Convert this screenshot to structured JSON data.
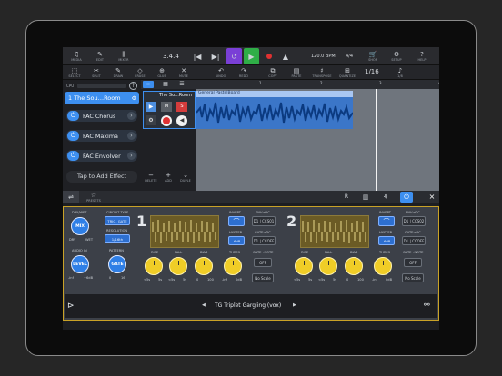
{
  "toolbar": {
    "media": "MEDIA",
    "edit": "EDIT",
    "mixer": "MIXER",
    "position": "3.4.4",
    "tempo": "120.0 BPM",
    "time_signature": "4/4",
    "shop": "SHOP",
    "setup": "SETUP",
    "help": "HELP"
  },
  "toolbar2": {
    "select": "SELECT",
    "split": "SPLIT",
    "draw": "DRAW",
    "erase": "ERASE",
    "glue": "GLUE",
    "mute": "MUTE",
    "undo": "UNDO",
    "redo": "REDO",
    "copy": "COPY",
    "paste": "PASTE",
    "transpose": "TRANSPOSE",
    "quantize": "QUANTIZE",
    "grid": "1/16",
    "grid_sub": "1/8"
  },
  "cpu_label": "CPU",
  "track": {
    "name": "1  The Sou…Room",
    "header_name": "The So...Room",
    "region_name": "General PastelBoard"
  },
  "effects": [
    {
      "name": "FAC Chorus"
    },
    {
      "name": "FAC Maxima"
    },
    {
      "name": "FAC Envolver"
    }
  ],
  "add_effect": "Tap to Add Effect",
  "track_actions": {
    "delete": "DELETE",
    "add": "ADD",
    "duple": "DUPLE"
  },
  "ruler": [
    "1",
    "2",
    "3",
    "4"
  ],
  "panel": {
    "presets_label": "PRESETS",
    "preset_name": "TG Triplet Gargling (vox)"
  },
  "plugin": {
    "dry_wet": "DRY/WET",
    "mix": "MIX",
    "dry": "DRY",
    "wet": "WET",
    "circuit_type": "CIRCUIT TYPE",
    "circuit_value": "TRIG, GATE",
    "resolution": "RESOLUTION",
    "resolution_value": "1/16th",
    "audio_in": "AUDIO IN",
    "level": "LEVEL",
    "level_min": "-inf",
    "level_max": "+6dB",
    "pattern": "PATTERN",
    "gate": "GATE",
    "pattern_min": "0",
    "pattern_max": "16",
    "channels": [
      {
        "number": "1",
        "invert": "INVERT",
        "env_rise": "ENV→DC",
        "env_value": "D1 | CCS01",
        "hyster": "HYSTER",
        "hyster_value": "-6dB",
        "gate_dc": "GATE→DC",
        "gate_dc_value": "D1 | CCOFF",
        "rise": "RISE",
        "fall": "FALL",
        "bias": "BIAS",
        "thres": "THRES",
        "gate_note": "GATE→NOTE",
        "off": "OFF",
        "no_scale": "No Scale"
      },
      {
        "number": "2",
        "invert": "INVERT",
        "env_rise": "ENV→DC",
        "env_value": "D1 | CCS02",
        "hyster": "HYSTER",
        "hyster_value": "-6dB",
        "gate_dc": "GATE→DC",
        "gate_dc_value": "D1 | CCOFF",
        "rise": "RISE",
        "fall": "FALL",
        "bias": "BIAS",
        "thres": "THRES",
        "gate_note": "GATE→NOTE",
        "off": "OFF",
        "no_scale": "No Scale"
      }
    ],
    "knob_ranges": {
      "rise_min": "<5s",
      "rise_max": "5s",
      "fall_min": "<5s",
      "fall_max": "5s",
      "bias_min": "0",
      "bias_max": "100",
      "thres_min": "-inf",
      "thres_max": "0dB"
    }
  },
  "colors": {
    "accent": "#3d8ff0",
    "transport_loop": "#7a3fd6",
    "transport_play": "#2fae47",
    "record": "#e03131",
    "region": "#3b76c8",
    "plugin_border": "#c9a227"
  }
}
